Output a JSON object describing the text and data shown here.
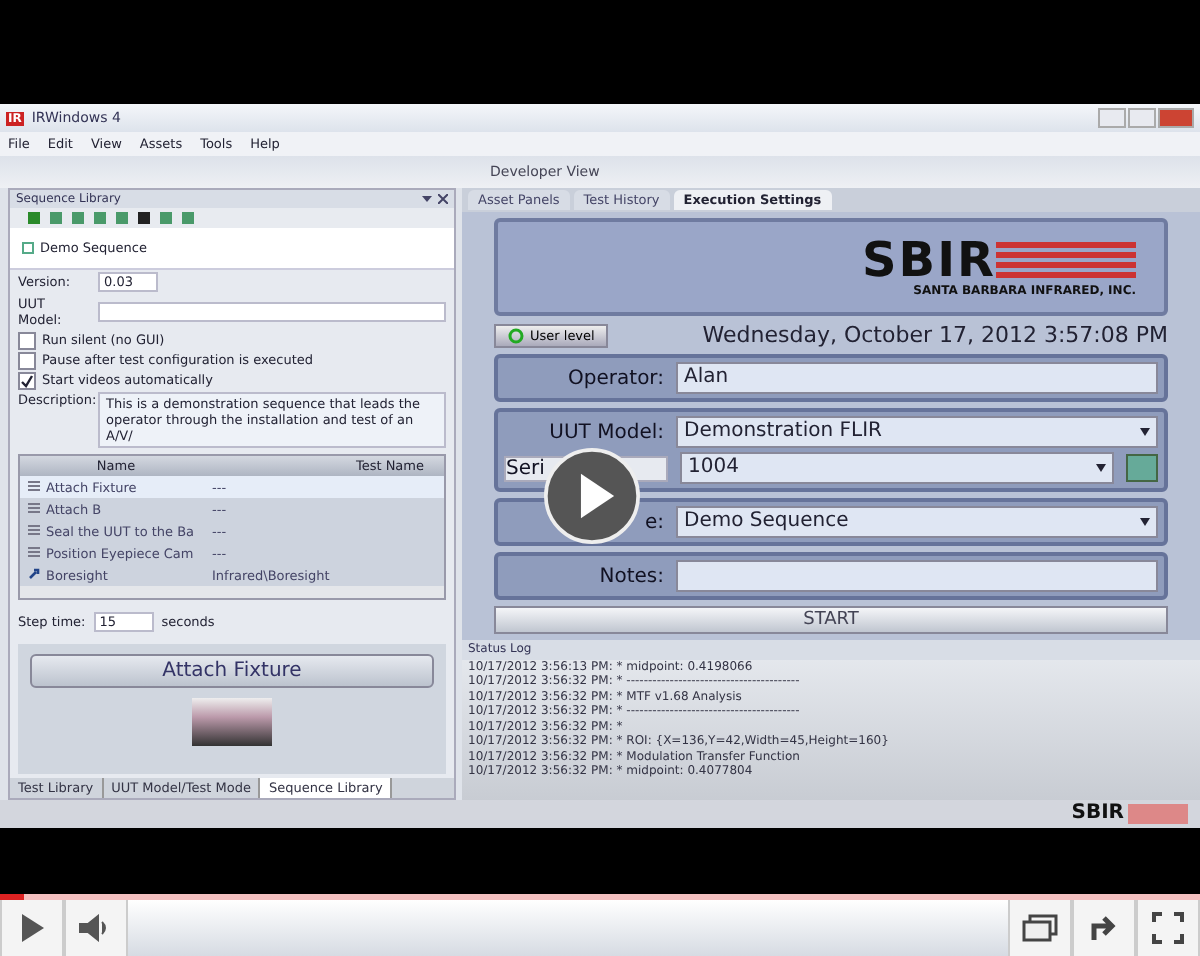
{
  "window": {
    "title": "IRWindows 4",
    "logo": "IR"
  },
  "menu": [
    "File",
    "Edit",
    "View",
    "Assets",
    "Tools",
    "Help"
  ],
  "view_title": "Developer View",
  "sequence_library": {
    "title": "Sequence Library",
    "tree_item": "Demo Sequence",
    "version_label": "Version:",
    "version": "0.03",
    "uut_model_label": "UUT Model:",
    "options": [
      {
        "label": "Run silent (no GUI)",
        "checked": false
      },
      {
        "label": "Pause after test configuration is executed",
        "checked": false
      },
      {
        "label": "Start videos automatically",
        "checked": true
      }
    ],
    "description_label": "Description:",
    "description": "This is a demonstration sequence that leads the operator through the installation and test of an A/V/",
    "columns": [
      "Name",
      "Test Name"
    ],
    "rows": [
      {
        "name": "Attach Fixture",
        "test": "---",
        "selected": true,
        "kind": "step"
      },
      {
        "name": "Attach B",
        "test": "---",
        "selected": false,
        "kind": "step"
      },
      {
        "name": "Seal the UUT to the Ba",
        "test": "---",
        "selected": false,
        "kind": "step"
      },
      {
        "name": "Position Eyepiece Cam",
        "test": "---",
        "selected": false,
        "kind": "step"
      },
      {
        "name": "Boresight",
        "test": "Infrared\\Boresight",
        "selected": false,
        "kind": "test"
      }
    ],
    "step_time_label": "Step time:",
    "step_time": "15",
    "step_time_unit": "seconds",
    "step_title": "Attach Fixture",
    "bottom_tabs": [
      {
        "label": "Test Library",
        "selected": false
      },
      {
        "label": "UUT Model/Test Mode",
        "selected": false
      },
      {
        "label": "Sequence Library",
        "selected": true
      }
    ]
  },
  "tabs": [
    {
      "label": "Asset Panels",
      "selected": false
    },
    {
      "label": "Test History",
      "selected": false
    },
    {
      "label": "Execution Settings",
      "selected": true
    }
  ],
  "logo": {
    "mark": "SBIR",
    "name": "SANTA BARBARA INFRARED, INC."
  },
  "user_level_button": "User level",
  "datetime": "Wednesday, October 17, 2012 3:57:08 PM",
  "operator": {
    "label": "Operator:",
    "value": "Alan"
  },
  "uut_model": {
    "label": "UUT Model:",
    "value": "Demonstration FLIR"
  },
  "serial": {
    "label": "Seri",
    "value": "1004"
  },
  "sequence": {
    "label": "e:",
    "value": "Demo Sequence"
  },
  "notes": {
    "label": "Notes:"
  },
  "start_button": "START",
  "status_log": {
    "title": "Status Log",
    "lines": [
      "10/17/2012 3:56:13 PM: * midpoint: 0.4198066",
      "10/17/2012 3:56:32 PM: * ----------------------------------------",
      "10/17/2012 3:56:32 PM: *   MTF v1.68 Analysis",
      "10/17/2012 3:56:32 PM: * ----------------------------------------",
      "10/17/2012 3:56:32 PM: *",
      "10/17/2012 3:56:32 PM: * ROI: {X=136,Y=42,Width=45,Height=160}",
      "10/17/2012 3:56:32 PM: * Modulation Transfer Function",
      "10/17/2012 3:56:32 PM: * midpoint: 0.4077804"
    ]
  },
  "footer_logo": "SBIR",
  "player": {
    "level": 0.02
  }
}
